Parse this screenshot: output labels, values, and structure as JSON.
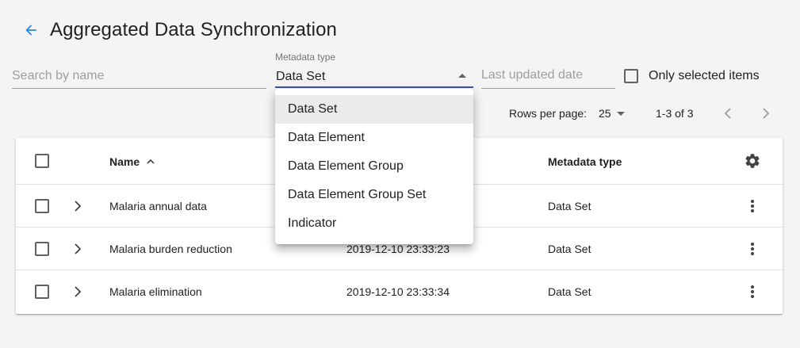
{
  "header": {
    "title": "Aggregated Data Synchronization"
  },
  "filters": {
    "search_placeholder": "Search by name",
    "metadata_type": {
      "label": "Metadata type",
      "value": "Data Set"
    },
    "date_placeholder": "Last updated date",
    "only_selected_label": "Only selected items"
  },
  "pagination": {
    "rows_per_page_label": "Rows per page:",
    "rows_per_page_value": "25",
    "range": "1-3 of 3"
  },
  "table": {
    "columns": {
      "name": "Name",
      "metadata_type": "Metadata type"
    },
    "rows": [
      {
        "name": "Malaria annual data",
        "last_updated": "",
        "metadata_type": "Data Set"
      },
      {
        "name": "Malaria burden reduction",
        "last_updated": "2019-12-10 23:33:23",
        "metadata_type": "Data Set"
      },
      {
        "name": "Malaria elimination",
        "last_updated": "2019-12-10 23:33:34",
        "metadata_type": "Data Set"
      }
    ]
  },
  "dropdown": {
    "options": [
      "Data Set",
      "Data Element",
      "Data Element Group",
      "Data Element Group Set",
      "Indicator"
    ],
    "selected_index": 0
  },
  "icons": {
    "back": "arrow-back-icon",
    "sort": "arrow-up-icon",
    "settings": "gear-icon",
    "expand": "chevron-right-icon",
    "more": "more-vert-icon",
    "prev": "chevron-left-icon",
    "next": "chevron-right-icon"
  },
  "colors": {
    "accent": "#1e88e5",
    "underline_active": "#3f51b5",
    "selected_option_bg": "#ebebeb"
  }
}
